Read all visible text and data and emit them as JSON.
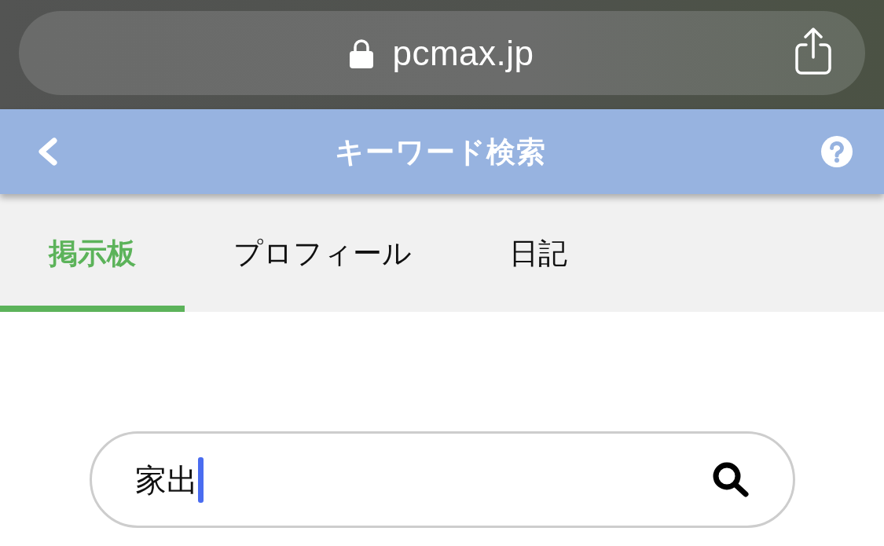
{
  "browser_bar": {
    "url": "pcmax.jp"
  },
  "header": {
    "title": "キーワード検索"
  },
  "tabs": [
    {
      "label": "掲示板",
      "selected": true
    },
    {
      "label": "プロフィール",
      "selected": false
    },
    {
      "label": "日記",
      "selected": false
    }
  ],
  "search": {
    "value": "家出",
    "focused": true
  }
}
